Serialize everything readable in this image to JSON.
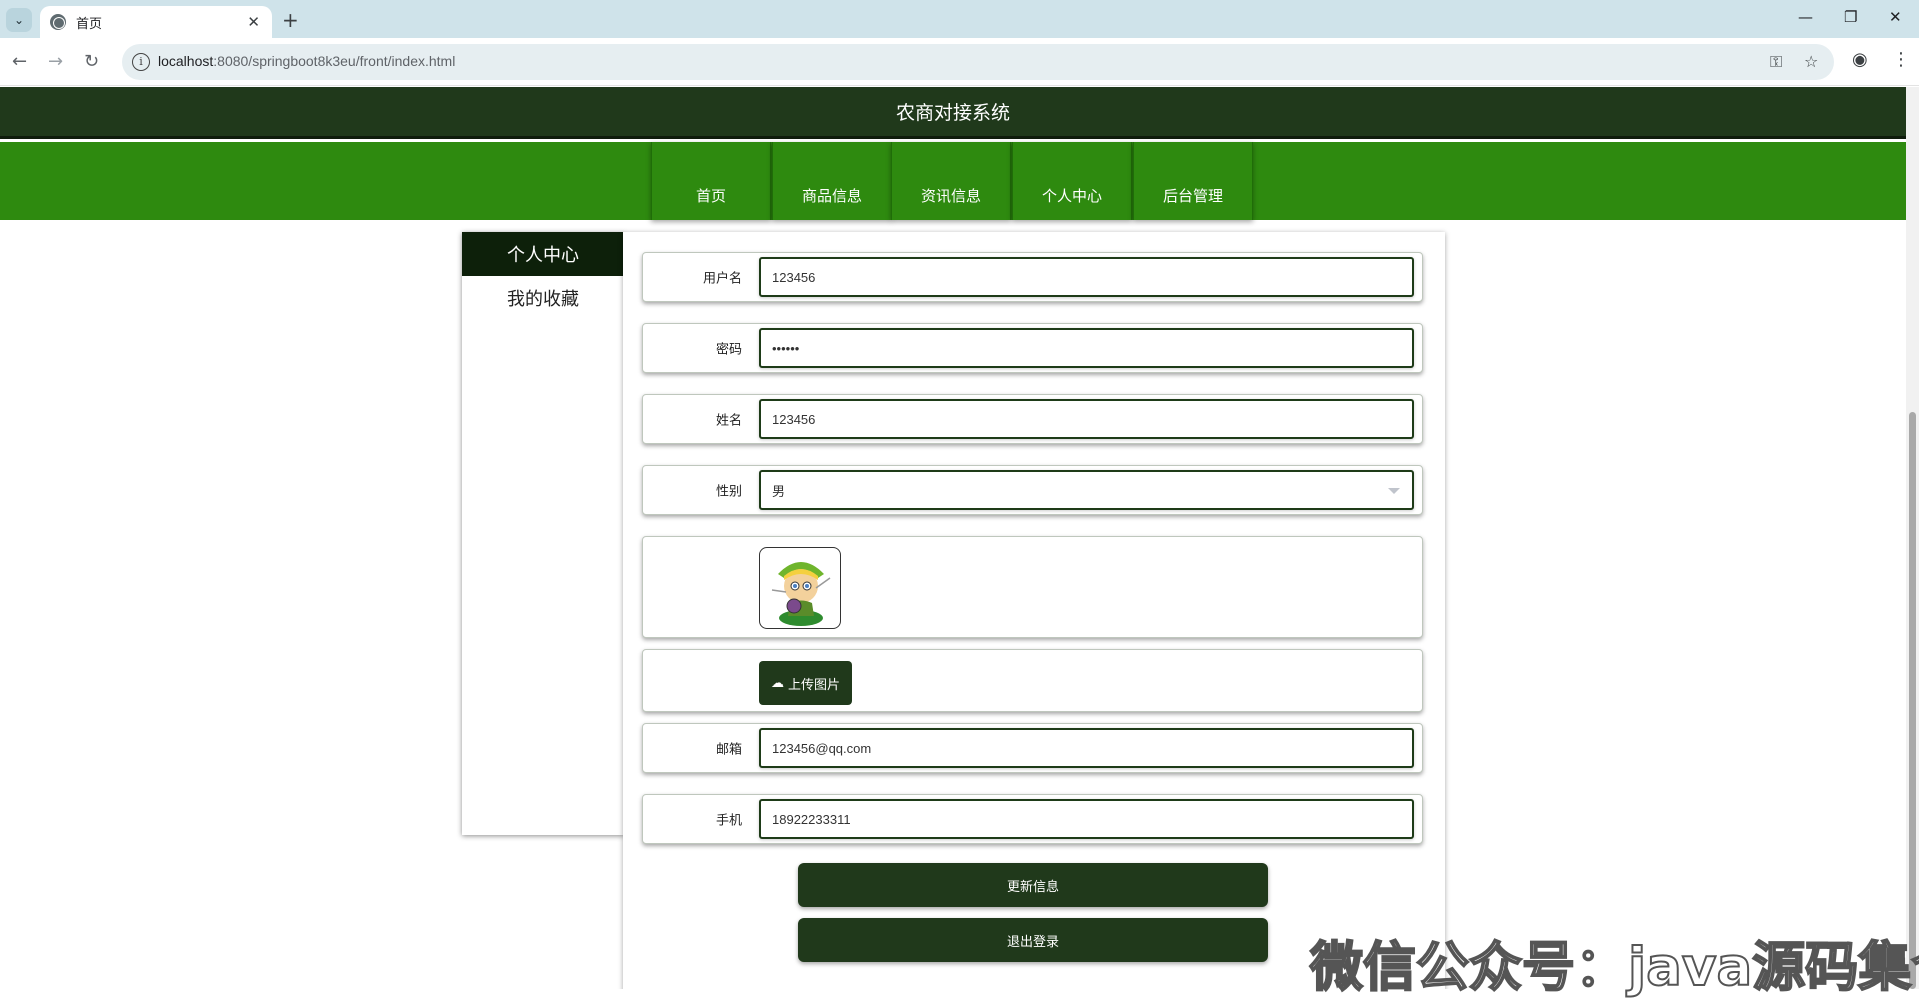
{
  "browser": {
    "tab_title": "首页",
    "url_host": "localhost",
    "url_rest": ":8080/springboot8k3eu/front/index.html"
  },
  "site": {
    "title": "农商对接系统",
    "nav": [
      "首页",
      "商品信息",
      "资讯信息",
      "个人中心",
      "后台管理"
    ]
  },
  "sidebar": {
    "items": [
      "个人中心",
      "我的收藏"
    ],
    "active_index": 0
  },
  "form": {
    "username": {
      "label": "用户名",
      "value": "123456"
    },
    "password": {
      "label": "密码",
      "value": "••••••"
    },
    "name": {
      "label": "姓名",
      "value": "123456"
    },
    "gender": {
      "label": "性别",
      "value": "男"
    },
    "upload_label": "上传图片",
    "email": {
      "label": "邮箱",
      "value": "123456@qq.com"
    },
    "phone": {
      "label": "手机",
      "value": "18922233311"
    }
  },
  "actions": {
    "update": "更新信息",
    "logout": "退出登录"
  },
  "watermark": "微信公众号：java源码集合",
  "colors": {
    "header_bg": "#20391b",
    "nav_bg": "#2e8a0f",
    "active_bg": "#0d200a",
    "button_bg": "#20391b"
  }
}
